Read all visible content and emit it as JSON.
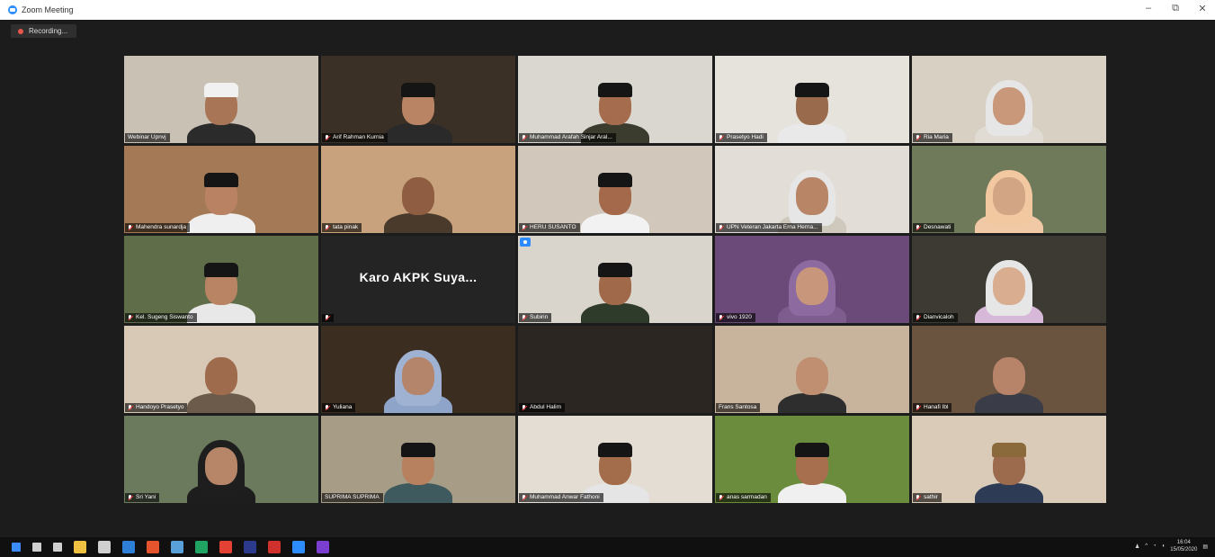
{
  "window": {
    "title": "Zoom Meeting"
  },
  "meeting": {
    "recording_label": "Recording..."
  },
  "participants": [
    {
      "name": "Webinar Upnvj",
      "muted": false,
      "bg": "#c9c1b4",
      "skin": "#a87656",
      "headwear": "white",
      "body": "#2b2b2b"
    },
    {
      "name": "Arif Rahman Kurnia",
      "muted": true,
      "bg": "#3a3026",
      "skin": "#b88463",
      "headwear": "black",
      "body": "#2a2a2a"
    },
    {
      "name": "Muhammad Arafah Sinjar Aral...",
      "muted": true,
      "bg": "#d9d7cf",
      "skin": "#a56d4d",
      "headwear": "black",
      "body": "#3b3b2e"
    },
    {
      "name": "Prasetyo Hadi",
      "muted": true,
      "bg": "#e6e3dd",
      "skin": "#9a6a4c",
      "headwear": "black",
      "body": "#e9e9e9"
    },
    {
      "name": "Ria Maria",
      "muted": true,
      "bg": "#d8d0c3",
      "skin": "#c9987a",
      "headwear": "hijab-white",
      "body": "#e0dcd4"
    },
    {
      "name": "Mahendra sunardja",
      "muted": true,
      "bg": "#a37a55",
      "skin": "#b98262",
      "headwear": "black",
      "body": "#efefef"
    },
    {
      "name": "tata pinak",
      "muted": true,
      "bg": "#c8a27d",
      "skin": "#8f5d41",
      "headwear": "none",
      "body": "#4a3a2c"
    },
    {
      "name": "HERU SUSANTO",
      "muted": true,
      "bg": "#d1c8bb",
      "skin": "#a3694a",
      "headwear": "black",
      "body": "#f2f2f2"
    },
    {
      "name": "UPN Veteran Jakarta Erna Herna...",
      "muted": true,
      "bg": "#e2ddd7",
      "skin": "#b88566",
      "headwear": "hijab-white",
      "body": "#cfc8bc"
    },
    {
      "name": "Desnawati",
      "muted": true,
      "bg": "#6f7a5a",
      "skin": "#d2a585",
      "headwear": "hijab-peach",
      "body": "#f1c9a6"
    },
    {
      "name": "Kel. Sugeng Siswanto",
      "muted": true,
      "bg": "#5f6e48",
      "skin": "#b88464",
      "headwear": "black",
      "body": "#e8e8e8"
    },
    {
      "name": "Karo AKPK Suya...",
      "muted": true,
      "video_off": true,
      "bg": "#242424",
      "skin": "",
      "headwear": "none",
      "body": ""
    },
    {
      "name": "Subirin",
      "muted": true,
      "bg": "#d9d4cc",
      "skin": "#a06a4a",
      "headwear": "black",
      "body": "#2e3a2a"
    },
    {
      "name": "vivo 1920",
      "muted": true,
      "bg": "#6b4a7a",
      "skin": "#c8967a",
      "headwear": "hijab-purple",
      "body": "#7f5c8e"
    },
    {
      "name": "Dianvicaloh",
      "muted": true,
      "bg": "#3c3a33",
      "skin": "#d8ad90",
      "headwear": "hijab-white",
      "body": "#d7b8d8"
    },
    {
      "name": "Handoyo Prasetyo",
      "muted": true,
      "bg": "#d7c9b6",
      "skin": "#9e6b4c",
      "headwear": "none",
      "body": "#6c5b4a"
    },
    {
      "name": "Yuliana",
      "muted": true,
      "bg": "#3b2e21",
      "skin": "#b4856b",
      "headwear": "hijab-blue",
      "body": "#8ea4c8"
    },
    {
      "name": "Abdul Halim",
      "muted": true,
      "bg": "#2b2622",
      "skin": "",
      "headwear": "none",
      "body": ""
    },
    {
      "name": "Frans Santosa",
      "muted": false,
      "bg": "#c8b49c",
      "skin": "#c08e70",
      "headwear": "none",
      "body": "#2e2e2e"
    },
    {
      "name": "Hanafi Ibl",
      "muted": true,
      "bg": "#6a5440",
      "skin": "#b7846a",
      "headwear": "none",
      "body": "#3a3d48"
    },
    {
      "name": "Sri Yani",
      "muted": true,
      "bg": "#6b7a5c",
      "skin": "#b78668",
      "headwear": "hijab-black",
      "body": "#1d1d1d"
    },
    {
      "name": "SUPRIMA SUPRIMA",
      "muted": false,
      "active": true,
      "bg": "#a79c85",
      "skin": "#b7805f",
      "headwear": "black",
      "body": "#3f5a5e"
    },
    {
      "name": "Muhammad Anwar Fathoni",
      "muted": true,
      "bg": "#e3ddd3",
      "skin": "#a36c4a",
      "headwear": "black",
      "body": "#e5e5e5"
    },
    {
      "name": "anas sarmadan",
      "muted": true,
      "bg": "#6b8c3c",
      "skin": "#a86f4f",
      "headwear": "black",
      "body": "#f0f0f0"
    },
    {
      "name": "sathir",
      "muted": true,
      "bg": "#d9cbb8",
      "skin": "#9c6a4d",
      "headwear": "brown",
      "body": "#2d3b55"
    }
  ],
  "taskbar": {
    "icons": [
      "start-icon",
      "search-icon",
      "task-view-icon",
      "file-explorer-icon",
      "store-icon",
      "mail-icon",
      "office-icon",
      "paint-icon",
      "chrome-icon",
      "chrome-icon-2",
      "photoshop-icon",
      "opera-icon",
      "zoom-icon",
      "premiere-icon"
    ],
    "time": "16:04",
    "date": "15/05/2020"
  }
}
